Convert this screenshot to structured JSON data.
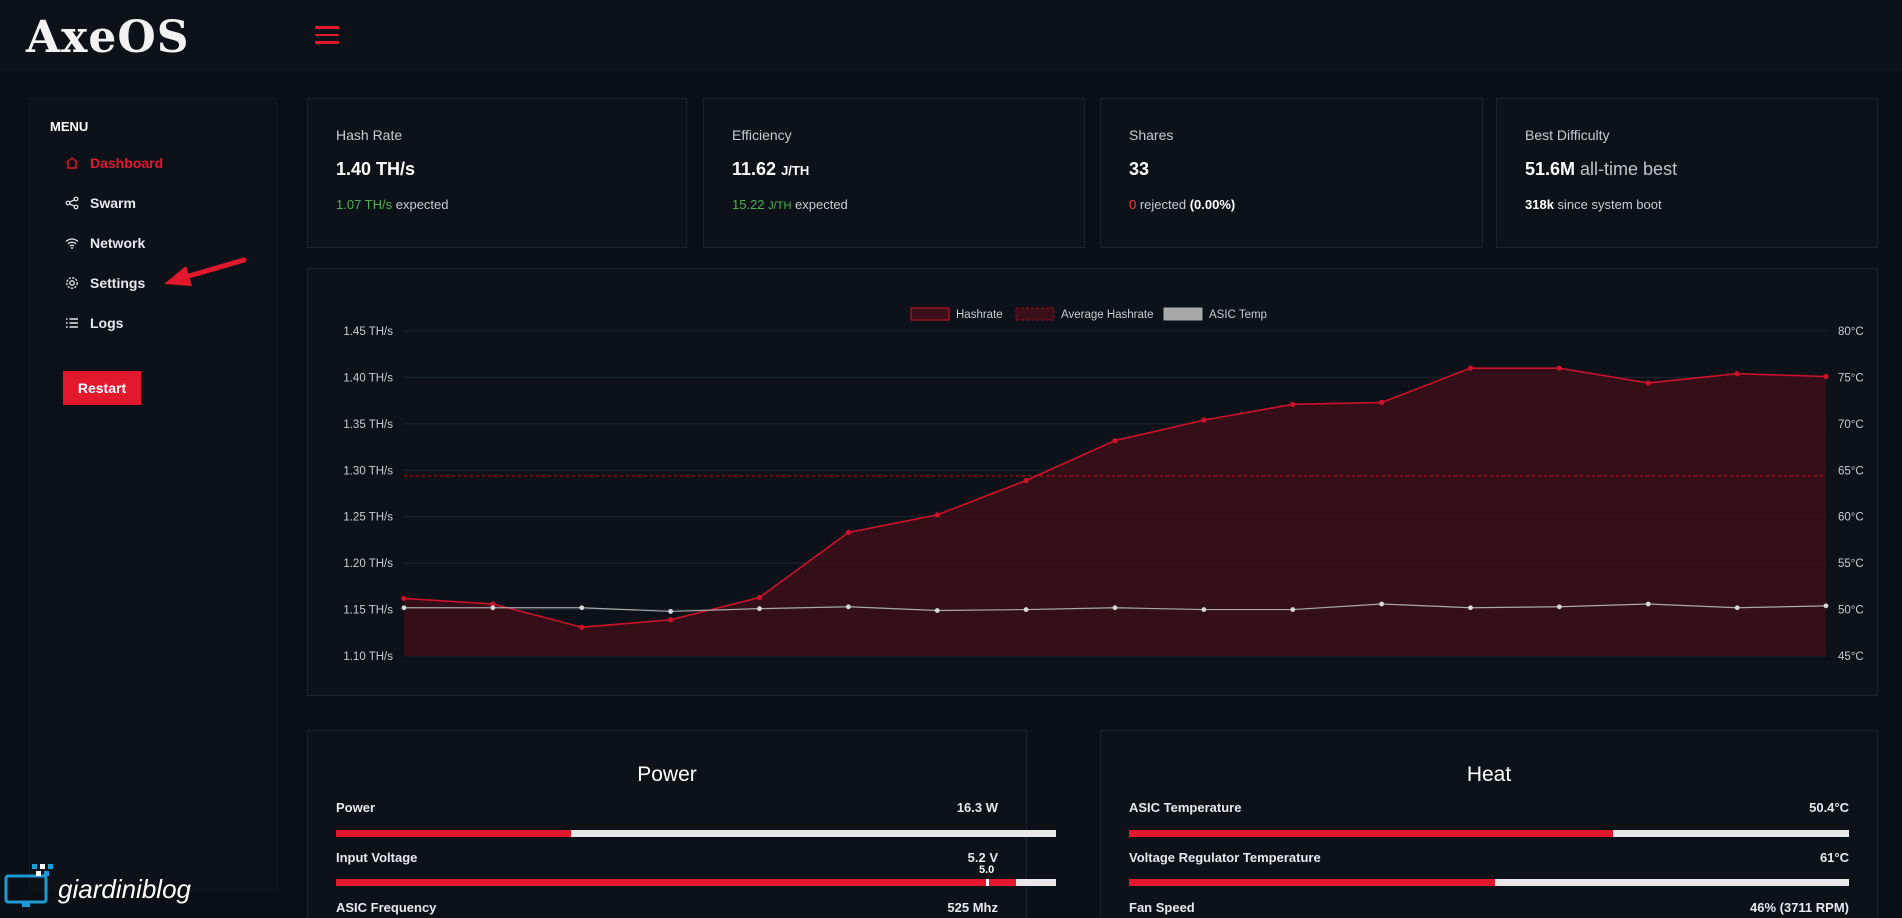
{
  "app": {
    "logo": "AxeOS"
  },
  "sidebar": {
    "menu_title": "MENU",
    "items": [
      {
        "label": "Dashboard",
        "icon": "home-icon",
        "active": true
      },
      {
        "label": "Swarm",
        "icon": "share-icon",
        "active": false
      },
      {
        "label": "Network",
        "icon": "wifi-icon",
        "active": false
      },
      {
        "label": "Settings",
        "icon": "gear-icon",
        "active": false
      },
      {
        "label": "Logs",
        "icon": "list-icon",
        "active": false
      }
    ],
    "restart_label": "Restart"
  },
  "stats": {
    "hashrate": {
      "label": "Hash Rate",
      "value": "1.40 TH/s",
      "expected_value": "1.07 TH/s",
      "expected_suffix": " expected"
    },
    "efficiency": {
      "label": "Efficiency",
      "value": "11.62",
      "unit": "J/TH",
      "expected_value": "15.22",
      "expected_unit": "J/TH",
      "expected_suffix": " expected"
    },
    "shares": {
      "label": "Shares",
      "value": "33",
      "rejected_count": "0",
      "rejected_text": " rejected ",
      "rejected_pct": "(0.00%)"
    },
    "best_difficulty": {
      "label": "Best Difficulty",
      "value": "51.6M",
      "value_suffix": " all-time best",
      "boot_value": "318k",
      "boot_suffix": " since system boot"
    }
  },
  "chart_data": {
    "type": "line",
    "legend": [
      "Hashrate",
      "Average Hashrate",
      "ASIC Temp"
    ],
    "legend_position": "top-center",
    "y_left_ticks": [
      "1.45 TH/s",
      "1.40 TH/s",
      "1.35 TH/s",
      "1.30 TH/s",
      "1.25 TH/s",
      "1.20 TH/s",
      "1.15 TH/s",
      "1.10 TH/s"
    ],
    "y_right_ticks": [
      "80°C",
      "75°C",
      "70°C",
      "65°C",
      "60°C",
      "55°C",
      "50°C",
      "45°C"
    ],
    "ylim_left": [
      1.1,
      1.45
    ],
    "ylim_right": [
      45,
      80
    ],
    "grid": true,
    "series": [
      {
        "name": "Hashrate",
        "color": "#d0112b",
        "values": [
          1.162,
          1.156,
          1.131,
          1.139,
          1.163,
          1.233,
          1.252,
          1.289,
          1.332,
          1.354,
          1.371,
          1.373,
          1.41,
          1.41,
          1.394,
          1.404,
          1.401
        ]
      },
      {
        "name": "Average Hashrate",
        "color": "#9b1020",
        "values": [
          1.294,
          1.294,
          1.294,
          1.294,
          1.294,
          1.294,
          1.294,
          1.294,
          1.294,
          1.294,
          1.294,
          1.294,
          1.294,
          1.294,
          1.294,
          1.294,
          1.294
        ]
      },
      {
        "name": "ASIC Temp",
        "color": "#a9a9a9",
        "values": [
          50.2,
          50.2,
          50.2,
          49.8,
          50.1,
          50.3,
          49.9,
          50.0,
          50.2,
          50.0,
          50.0,
          50.6,
          50.2,
          50.3,
          50.6,
          50.2,
          50.4
        ]
      }
    ]
  },
  "power": {
    "title": "Power",
    "rows": [
      {
        "label": "Power",
        "value": "16.3 W",
        "fill": 0.326
      },
      {
        "label": "Input Voltage",
        "value": "5.2 V",
        "fill": 0.945,
        "marker_label": "5.0",
        "marker": 0.905
      },
      {
        "label": "ASIC Frequency",
        "value": "525 Mhz"
      }
    ]
  },
  "heat": {
    "title": "Heat",
    "rows": [
      {
        "label": "ASIC Temperature",
        "value": "50.4°C",
        "fill": 0.672
      },
      {
        "label": "Voltage Regulator Temperature",
        "value": "61°C",
        "fill": 0.508
      },
      {
        "label": "Fan Speed",
        "value": "46% (3711 RPM)"
      }
    ]
  },
  "watermark": {
    "text": "giardiniblog"
  },
  "colors": {
    "accent": "#e3182d",
    "background": "#0b0f16",
    "card": "#0d1219"
  }
}
